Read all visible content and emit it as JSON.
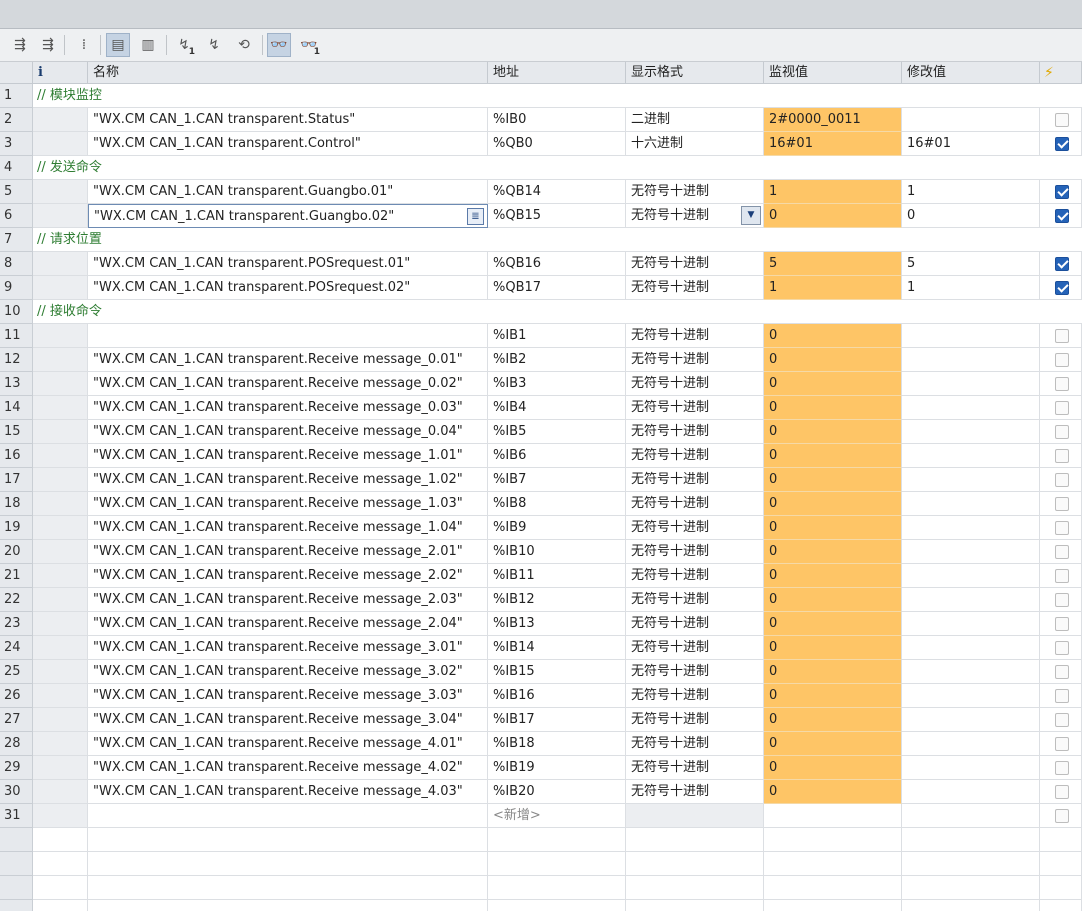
{
  "toolbar": {
    "icons": [
      "refresh-names-icon",
      "refresh-names-2-icon",
      "insert-row-icon",
      "show-hide-columns-icon",
      "show-modify-columns-icon",
      "modify-once-icon",
      "modify-trigger-icon",
      "monitor-modify-icon",
      "monitor-all-icon",
      "monitor-once-icon"
    ],
    "sub1": "1",
    "sub2": "1"
  },
  "headers": {
    "info": "i",
    "name": "名称",
    "address": "地址",
    "format": "显示格式",
    "monitor": "监视值",
    "modify": "修改值",
    "bolt": "⚡"
  },
  "rows": [
    {
      "n": "1",
      "type": "comment",
      "text": "// 模块监控"
    },
    {
      "n": "2",
      "type": "data",
      "name": "\"WX.CM CAN_1.CAN transparent.Status\"",
      "addr": "%IB0",
      "fmt": "二进制",
      "mon": "2#0000_0011",
      "mod": "",
      "chk": false
    },
    {
      "n": "3",
      "type": "data",
      "name": "\"WX.CM CAN_1.CAN transparent.Control\"",
      "addr": "%QB0",
      "fmt": "十六进制",
      "mon": "16#01",
      "mod": "16#01",
      "chk": true
    },
    {
      "n": "4",
      "type": "comment",
      "text": "// 发送命令"
    },
    {
      "n": "5",
      "type": "data",
      "name": "\"WX.CM CAN_1.CAN transparent.Guangbo.01\"",
      "addr": "%QB14",
      "fmt": "无符号十进制",
      "mon": "1",
      "mod": "1",
      "chk": true
    },
    {
      "n": "6",
      "type": "data",
      "name": "\"WX.CM CAN_1.CAN transparent.Guangbo.02\"",
      "addr": "%QB15",
      "fmt": "无符号十进制",
      "mon": "0",
      "mod": "0",
      "chk": true,
      "editing": true
    },
    {
      "n": "7",
      "type": "comment",
      "text": "// 请求位置"
    },
    {
      "n": "8",
      "type": "data",
      "name": "\"WX.CM CAN_1.CAN transparent.POSrequest.01\"",
      "addr": "%QB16",
      "fmt": "无符号十进制",
      "mon": "5",
      "mod": "5",
      "chk": true
    },
    {
      "n": "9",
      "type": "data",
      "name": "\"WX.CM CAN_1.CAN transparent.POSrequest.02\"",
      "addr": "%QB17",
      "fmt": "无符号十进制",
      "mon": "1",
      "mod": "1",
      "chk": true
    },
    {
      "n": "10",
      "type": "comment",
      "text": "// 接收命令"
    },
    {
      "n": "11",
      "type": "data",
      "name": "",
      "addr": "%IB1",
      "fmt": "无符号十进制",
      "mon": "0",
      "mod": "",
      "chk": false
    },
    {
      "n": "12",
      "type": "data",
      "name": "\"WX.CM CAN_1.CAN transparent.Receive message_0.01\"",
      "addr": "%IB2",
      "fmt": "无符号十进制",
      "mon": "0",
      "mod": "",
      "chk": false
    },
    {
      "n": "13",
      "type": "data",
      "name": "\"WX.CM CAN_1.CAN transparent.Receive message_0.02\"",
      "addr": "%IB3",
      "fmt": "无符号十进制",
      "mon": "0",
      "mod": "",
      "chk": false
    },
    {
      "n": "14",
      "type": "data",
      "name": "\"WX.CM CAN_1.CAN transparent.Receive message_0.03\"",
      "addr": "%IB4",
      "fmt": "无符号十进制",
      "mon": "0",
      "mod": "",
      "chk": false
    },
    {
      "n": "15",
      "type": "data",
      "name": "\"WX.CM CAN_1.CAN transparent.Receive message_0.04\"",
      "addr": "%IB5",
      "fmt": "无符号十进制",
      "mon": "0",
      "mod": "",
      "chk": false
    },
    {
      "n": "16",
      "type": "data",
      "name": "\"WX.CM CAN_1.CAN transparent.Receive message_1.01\"",
      "addr": "%IB6",
      "fmt": "无符号十进制",
      "mon": "0",
      "mod": "",
      "chk": false
    },
    {
      "n": "17",
      "type": "data",
      "name": "\"WX.CM CAN_1.CAN transparent.Receive message_1.02\"",
      "addr": "%IB7",
      "fmt": "无符号十进制",
      "mon": "0",
      "mod": "",
      "chk": false
    },
    {
      "n": "18",
      "type": "data",
      "name": "\"WX.CM CAN_1.CAN transparent.Receive message_1.03\"",
      "addr": "%IB8",
      "fmt": "无符号十进制",
      "mon": "0",
      "mod": "",
      "chk": false
    },
    {
      "n": "19",
      "type": "data",
      "name": "\"WX.CM CAN_1.CAN transparent.Receive message_1.04\"",
      "addr": "%IB9",
      "fmt": "无符号十进制",
      "mon": "0",
      "mod": "",
      "chk": false
    },
    {
      "n": "20",
      "type": "data",
      "name": "\"WX.CM CAN_1.CAN transparent.Receive message_2.01\"",
      "addr": "%IB10",
      "fmt": "无符号十进制",
      "mon": "0",
      "mod": "",
      "chk": false
    },
    {
      "n": "21",
      "type": "data",
      "name": "\"WX.CM CAN_1.CAN transparent.Receive message_2.02\"",
      "addr": "%IB11",
      "fmt": "无符号十进制",
      "mon": "0",
      "mod": "",
      "chk": false
    },
    {
      "n": "22",
      "type": "data",
      "name": "\"WX.CM CAN_1.CAN transparent.Receive message_2.03\"",
      "addr": "%IB12",
      "fmt": "无符号十进制",
      "mon": "0",
      "mod": "",
      "chk": false
    },
    {
      "n": "23",
      "type": "data",
      "name": "\"WX.CM CAN_1.CAN transparent.Receive message_2.04\"",
      "addr": "%IB13",
      "fmt": "无符号十进制",
      "mon": "0",
      "mod": "",
      "chk": false
    },
    {
      "n": "24",
      "type": "data",
      "name": "\"WX.CM CAN_1.CAN transparent.Receive message_3.01\"",
      "addr": "%IB14",
      "fmt": "无符号十进制",
      "mon": "0",
      "mod": "",
      "chk": false
    },
    {
      "n": "25",
      "type": "data",
      "name": "\"WX.CM CAN_1.CAN transparent.Receive message_3.02\"",
      "addr": "%IB15",
      "fmt": "无符号十进制",
      "mon": "0",
      "mod": "",
      "chk": false
    },
    {
      "n": "26",
      "type": "data",
      "name": "\"WX.CM CAN_1.CAN transparent.Receive message_3.03\"",
      "addr": "%IB16",
      "fmt": "无符号十进制",
      "mon": "0",
      "mod": "",
      "chk": false
    },
    {
      "n": "27",
      "type": "data",
      "name": "\"WX.CM CAN_1.CAN transparent.Receive message_3.04\"",
      "addr": "%IB17",
      "fmt": "无符号十进制",
      "mon": "0",
      "mod": "",
      "chk": false
    },
    {
      "n": "28",
      "type": "data",
      "name": "\"WX.CM CAN_1.CAN transparent.Receive message_4.01\"",
      "addr": "%IB18",
      "fmt": "无符号十进制",
      "mon": "0",
      "mod": "",
      "chk": false
    },
    {
      "n": "29",
      "type": "data",
      "name": "\"WX.CM CAN_1.CAN transparent.Receive message_4.02\"",
      "addr": "%IB19",
      "fmt": "无符号十进制",
      "mon": "0",
      "mod": "",
      "chk": false
    },
    {
      "n": "30",
      "type": "data",
      "name": "\"WX.CM CAN_1.CAN transparent.Receive message_4.03\"",
      "addr": "%IB20",
      "fmt": "无符号十进制",
      "mon": "0",
      "mod": "",
      "chk": false
    },
    {
      "n": "31",
      "type": "add",
      "addr": "<新增>"
    }
  ],
  "colors": {
    "monitor_bg": "#fec566",
    "comment": "#2e7d32",
    "check_on": "#2563b8"
  }
}
